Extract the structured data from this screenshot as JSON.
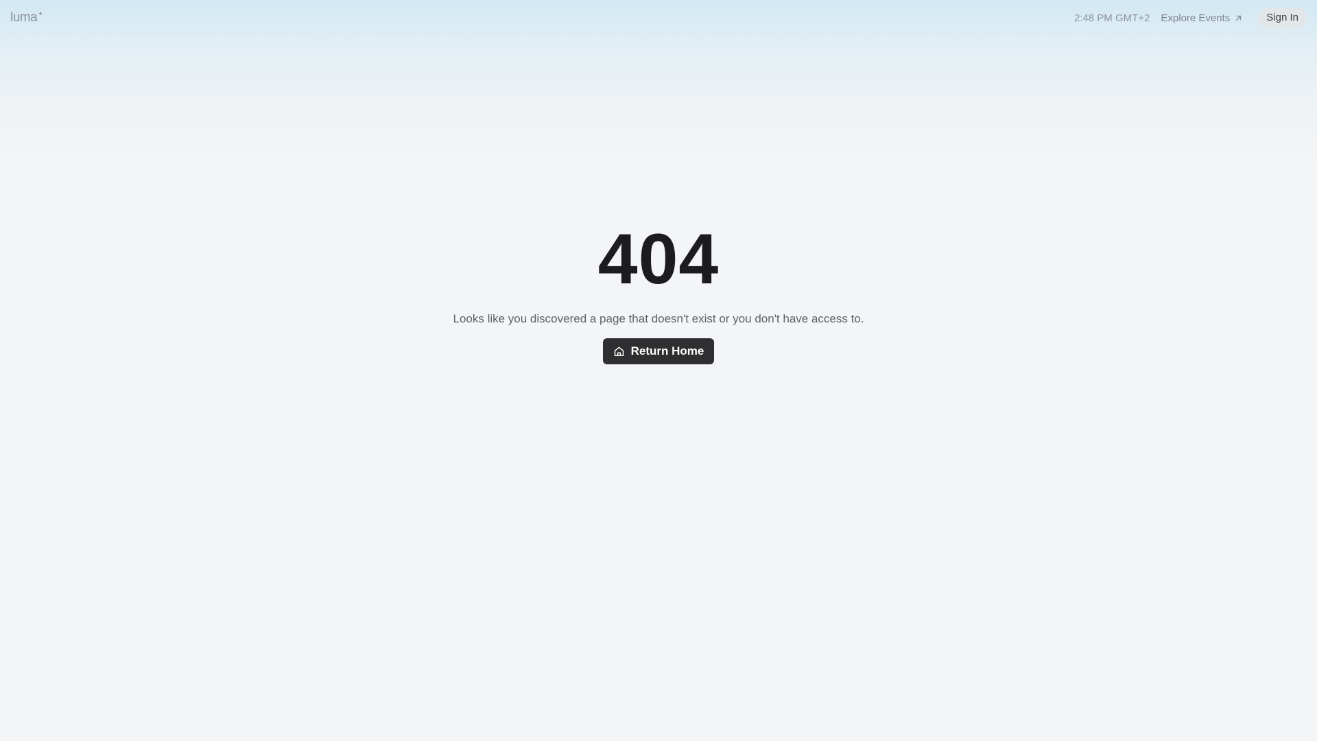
{
  "header": {
    "logo_text": "luma",
    "logo_mark": "✦",
    "time": "2:48 PM GMT+2",
    "explore_label": "Explore Events",
    "explore_icon": "arrow-up-right-icon",
    "signin_label": "Sign In"
  },
  "main": {
    "code": "404",
    "message": "Looks like you discovered a page that doesn't exist or you don't have access to.",
    "button_label": "Return Home",
    "button_icon": "home-icon"
  },
  "colors": {
    "background": "#f4f5f7",
    "header_tint": "#d2e8f3",
    "button_bg": "#2f2f31",
    "heading": "#1c1c1e",
    "muted_text": "#8e959c"
  }
}
